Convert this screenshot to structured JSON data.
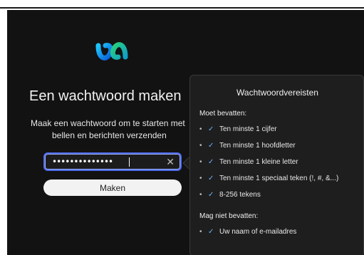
{
  "colors": {
    "background": "#121212",
    "panel": "#1e1e1e",
    "focus_border": "#4f6cf0",
    "check": "#6cb3ff",
    "button_bg": "#f2f2f2"
  },
  "icons": {
    "logo": "webex-logo-icon",
    "clear": "close-icon",
    "check": "checkmark-icon"
  },
  "form": {
    "title": "Een wachtwoord maken",
    "subtitle_line1": "Maak een wachtwoord om te starten met",
    "subtitle_line2": "bellen en berichten verzenden",
    "password_value": "••••••••••••••",
    "clear_glyph": "✕",
    "submit_label": "Maken"
  },
  "requirements": {
    "title": "Wachtwoordvereisten",
    "must_contain_label": "Moet bevatten:",
    "must_contain": [
      "Ten minste 1 cijfer",
      "Ten minste 1 hoofdletter",
      "Ten minste 1 kleine letter",
      "Ten minste 1 speciaal teken (!, #, &...)",
      "8-256 tekens"
    ],
    "must_not_contain_label": "Mag niet bevatten:",
    "must_not_contain": [
      "Uw naam of e-mailadres"
    ],
    "bullet": "•",
    "check": "✓"
  }
}
